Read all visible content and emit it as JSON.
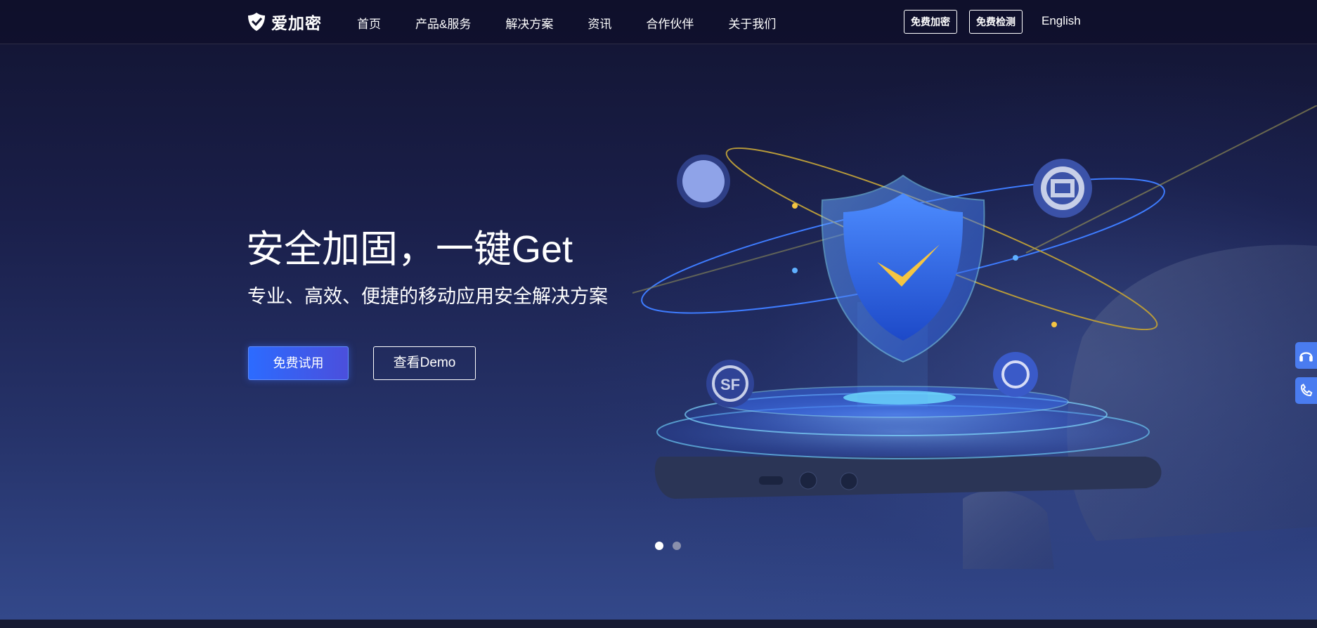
{
  "header": {
    "logo_text": "爱加密",
    "nav": [
      "首页",
      "产品&服务",
      "解决方案",
      "资讯",
      "合作伙伴",
      "关于我们"
    ],
    "free_encrypt": "免费加密",
    "free_detect": "免费检测",
    "language": "English"
  },
  "hero": {
    "title": "安全加固，一键Get",
    "subtitle": "专业、高效、便捷的移动应用安全解决方案",
    "primary_button": "免费试用",
    "secondary_button": "查看Demo",
    "badge_sf": "SF"
  },
  "carousel": {
    "slides": 2,
    "active": 1
  },
  "side_tools": [
    "headset-icon",
    "phone-icon"
  ],
  "colors": {
    "accent": "#2c6bff",
    "shield": "#3b82f6",
    "check": "#f5c542",
    "background": "#1a1f4a"
  }
}
